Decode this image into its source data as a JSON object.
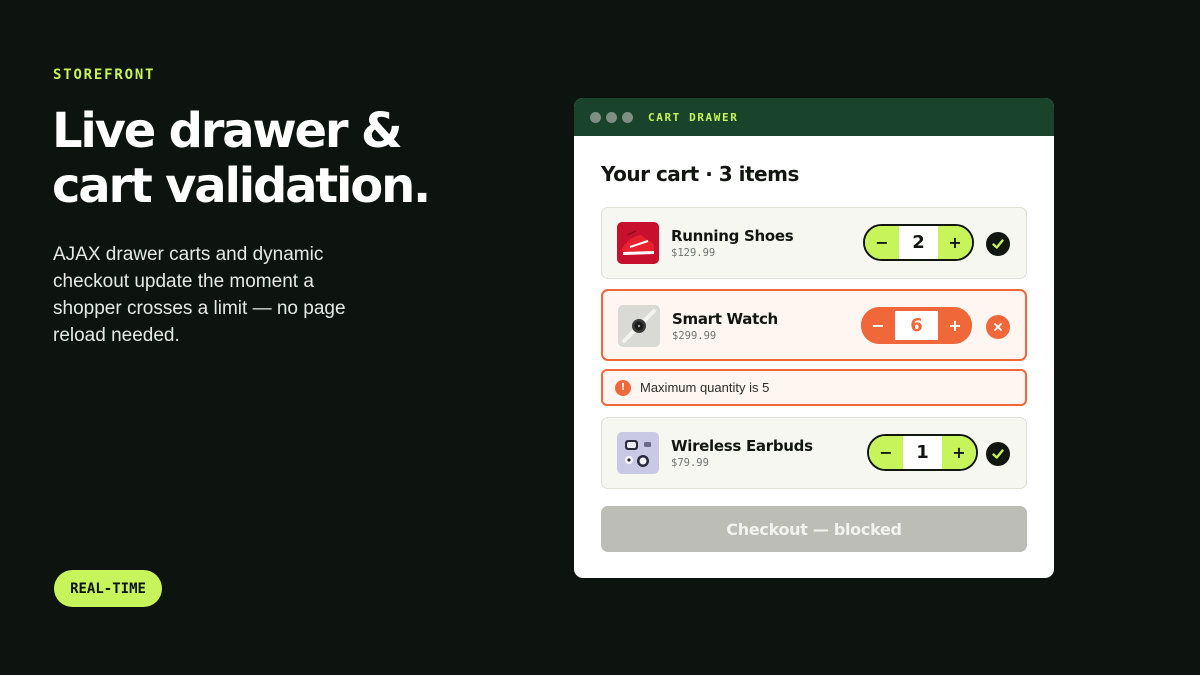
{
  "hero": {
    "eyebrow": "STOREFRONT",
    "headline_line1": "Live drawer &",
    "headline_line2": "cart validation.",
    "subcopy": "AJAX drawer carts and dynamic checkout update the moment a shopper crosses a limit — no page reload needed.",
    "badge": "REAL-TIME"
  },
  "window": {
    "title": "CART DRAWER",
    "heading": "Your cart · 3 items",
    "items": [
      {
        "name": "Running Shoes",
        "price": "$129.99",
        "qty": "2",
        "minus": "−",
        "plus": "+",
        "thumb_icon": "running-shoe-icon",
        "status_icon": "check-icon",
        "valid": true
      },
      {
        "name": "Smart Watch",
        "price": "$299.99",
        "qty": "6",
        "minus": "−",
        "plus": "+",
        "thumb_icon": "smart-watch-icon",
        "status_icon": "close-icon",
        "valid": false
      },
      {
        "name": "Wireless Earbuds",
        "price": "$79.99",
        "qty": "1",
        "minus": "−",
        "plus": "+",
        "thumb_icon": "earbuds-icon",
        "status_icon": "check-icon",
        "valid": true
      }
    ],
    "error": {
      "icon_glyph": "!",
      "message": "Maximum quantity is 5"
    },
    "checkout_label": "Checkout — blocked"
  },
  "colors": {
    "background": "#0d1410",
    "accent": "#c7f35b",
    "error": "#f0673a",
    "titlebar": "#19442b",
    "disabled": "#bcbdb7"
  }
}
